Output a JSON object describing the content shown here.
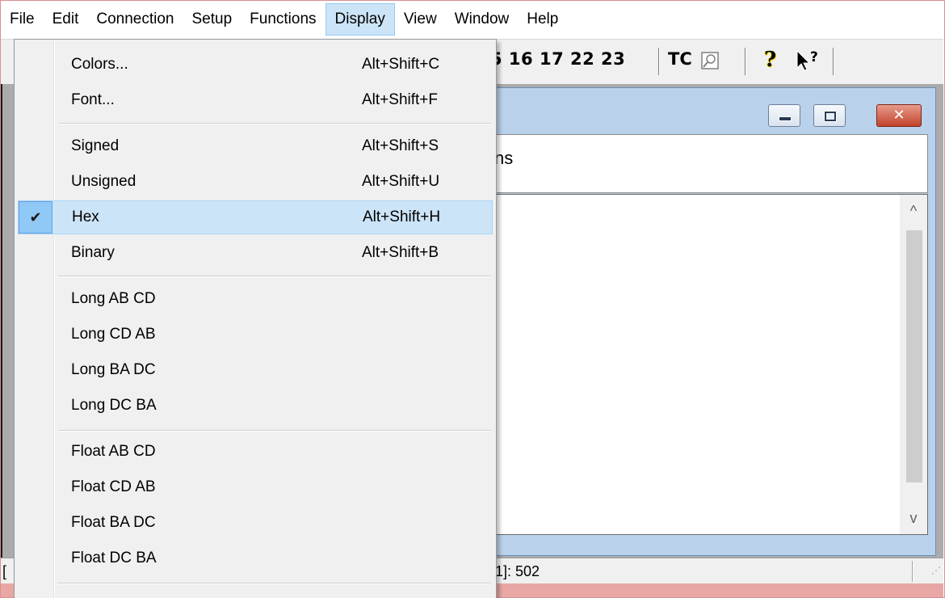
{
  "menubar": {
    "items": [
      "File",
      "Edit",
      "Connection",
      "Setup",
      "Functions",
      "Display",
      "View",
      "Window",
      "Help"
    ],
    "active": "Display"
  },
  "toolbar": {
    "numbers_text": "5 16 17 22 23",
    "tc_label": "TC",
    "icons": [
      "tc-view-icon",
      "help-icon",
      "whats-this-icon"
    ]
  },
  "child_window": {
    "header_text": "ns",
    "scroll_up_glyph": "^",
    "scroll_down_glyph": "v"
  },
  "statusbar": {
    "left_text": "[",
    "text": "1]: 502"
  },
  "display_menu": {
    "items": [
      {
        "label": "Colors...",
        "shortcut": "Alt+Shift+C"
      },
      {
        "label": "Font...",
        "shortcut": "Alt+Shift+F"
      },
      {
        "label": "Signed",
        "shortcut": "Alt+Shift+S"
      },
      {
        "label": "Unsigned",
        "shortcut": "Alt+Shift+U"
      },
      {
        "label": "Hex",
        "shortcut": "Alt+Shift+H",
        "checked": true
      },
      {
        "label": "Binary",
        "shortcut": "Alt+Shift+B"
      },
      {
        "label": "Long AB CD"
      },
      {
        "label": "Long CD AB"
      },
      {
        "label": "Long BA DC"
      },
      {
        "label": "Long DC BA"
      },
      {
        "label": "Float AB CD"
      },
      {
        "label": "Float CD AB"
      },
      {
        "label": "Float BA DC"
      },
      {
        "label": "Float DC BA"
      }
    ],
    "check_glyph": "✔"
  },
  "colors": {
    "menu_highlight": "#cce4f7",
    "check_highlight": "#90c8f6",
    "close_button": "#c2432d",
    "caption": "#b9d1ea"
  }
}
